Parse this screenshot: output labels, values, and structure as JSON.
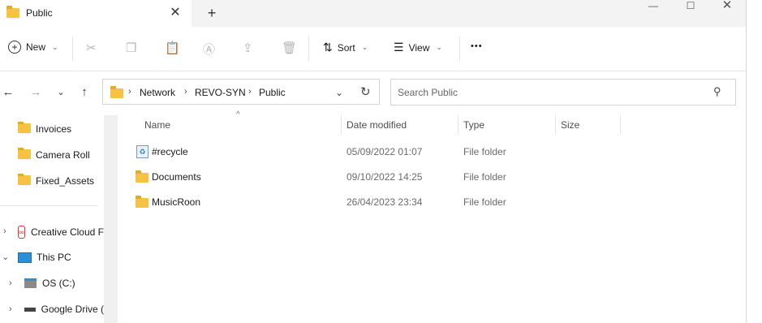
{
  "tab": {
    "title": "Public"
  },
  "window": {
    "minimize_icon": "—",
    "maximize_icon": "☐",
    "close_icon": "✕"
  },
  "commandbar": {
    "new_label": "New",
    "sort_label": "Sort",
    "view_label": "View",
    "more_label": "•••"
  },
  "address": {
    "segments": [
      "Network",
      "REVO-SYN",
      "Public"
    ]
  },
  "search": {
    "placeholder": "Search Public"
  },
  "columns": {
    "name": "Name",
    "date": "Date modified",
    "type": "Type",
    "size": "Size"
  },
  "files": [
    {
      "name": "#recycle",
      "date": "05/09/2022 01:07",
      "type": "File folder",
      "icon": "recycle-bin-folder-icon"
    },
    {
      "name": "Documents",
      "date": "09/10/2022 14:25",
      "type": "File folder",
      "icon": "folder-icon"
    },
    {
      "name": "MusicRoon",
      "date": "26/04/2023 23:34",
      "type": "File folder",
      "icon": "folder-icon"
    }
  ],
  "sidebar": {
    "quick_access": [
      "Invoices",
      "Camera Roll",
      "Fixed_Assets"
    ],
    "tree": [
      "Creative Cloud F",
      "This PC",
      "OS (C:)",
      "Google Drive ("
    ]
  },
  "colors": {
    "accent": "#0067c0",
    "folder": "#f6c242"
  }
}
